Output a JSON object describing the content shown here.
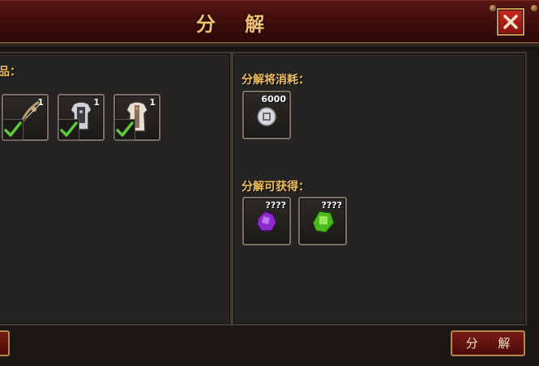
{
  "dialog": {
    "title": "分 解",
    "close_label": "X"
  },
  "left_panel": {
    "header_fragment": "品：",
    "items": [
      {
        "icon": "bow-icon",
        "count": "1",
        "selected": true
      },
      {
        "icon": "armor-icon",
        "count": "1",
        "selected": true
      },
      {
        "icon": "robe-armor-icon",
        "count": "1",
        "selected": true
      }
    ]
  },
  "right_panel": {
    "cost_label": "分解将消耗：",
    "cost_items": [
      {
        "icon": "silver-coin-icon",
        "count": "6000"
      }
    ],
    "reward_label": "分解可获得：",
    "reward_items": [
      {
        "icon": "purple-gem-icon",
        "count": "????"
      },
      {
        "icon": "green-gem-icon",
        "count": "????"
      }
    ]
  },
  "buttons": {
    "decompose_label": "分 解"
  },
  "colors": {
    "title_gold": "#f0c070",
    "label_gold": "#f0c060",
    "titlebar_red": "#5a1614",
    "check_green": "#5cc83a"
  }
}
